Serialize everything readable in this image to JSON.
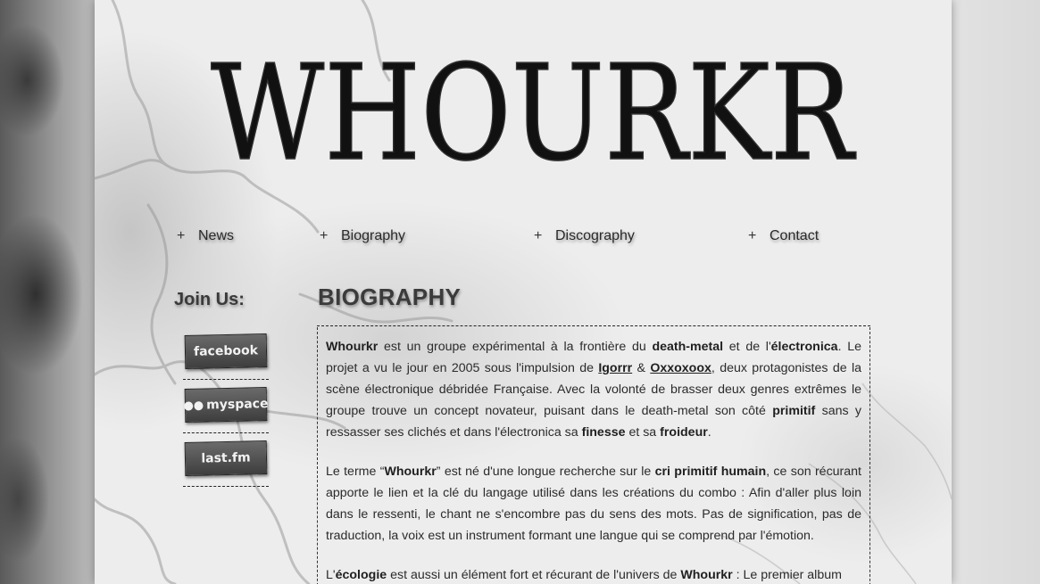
{
  "site": {
    "logo_text": "WHOURKR"
  },
  "nav": {
    "items": [
      {
        "plus": "+",
        "label": "News"
      },
      {
        "plus": "+",
        "label": "Biography"
      },
      {
        "plus": "+",
        "label": "Discography"
      },
      {
        "plus": "+",
        "label": "Contact"
      }
    ]
  },
  "sidebar": {
    "title": "Join Us:",
    "social": [
      {
        "label": "facebook",
        "icon": "facebook-icon"
      },
      {
        "label": "myspace",
        "icon": "myspace-icon"
      },
      {
        "label": "last.fm",
        "icon": "lastfm-icon"
      }
    ]
  },
  "main": {
    "title": "BIOGRAPHY",
    "p1": {
      "s1": "Whourkr",
      "s2": " est un groupe expérimental à la frontière du ",
      "s3": "death-metal",
      "s4": " et de l'",
      "s5": "électronica",
      "s6": ". Le projet a vu le jour en 2005 sous l'impulsion de ",
      "link1": "Igorrr",
      "s7": " & ",
      "link2": "Oxxoxoox",
      "s8": ", deux protagonistes de la scène électronique débridée Française. Avec la volonté de brasser deux genres extrêmes le groupe trouve un concept novateur, puisant dans le death-metal son côté ",
      "s9": "primitif",
      "s10": " sans y ressasser ses clichés et dans l'électronica sa ",
      "s11": "finesse",
      "s12": " et sa ",
      "s13": "froideur",
      "s14": "."
    },
    "p2": {
      "s1": "Le terme “",
      "s2": "Whourkr",
      "s3": "” est né d'une longue recherche sur le ",
      "s4": "cri primitif humain",
      "s5": ", ce son récurant apporte le lien et la clé du langage utilisé dans les créations du combo : Afin d'aller plus loin dans le ressenti, le chant ne s'encombre pas du sens des mots. Pas de signification, pas de traduction, la voix est un instrument formant une langue qui se comprend par l'émotion."
    },
    "p3": {
      "s1": "L'",
      "s2": "écologie",
      "s3": " est aussi un élément fort et récurant de l'univers de ",
      "s4": "Whourkr",
      "s5": " : Le premier album"
    }
  }
}
